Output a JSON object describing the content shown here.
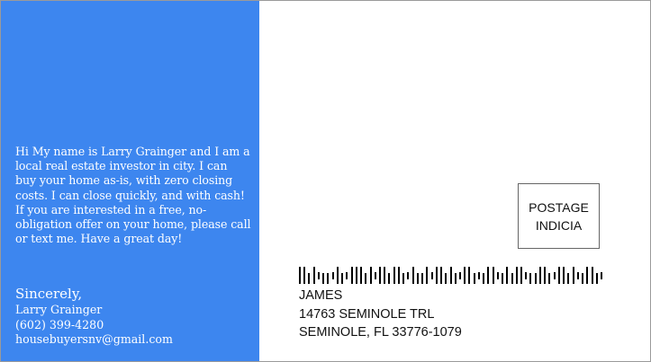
{
  "message": "Hi My name is Larry Grainger and I am a local real estate investor in city. I can buy your home as-is, with zero closing costs. I can close quickly, and with cash! If you are interested in a free, no-obligation offer on your home, please call or text me. Have a great day!",
  "closing": {
    "salutation": "Sincerely,",
    "name": "Larry Grainger",
    "phone": "(602) 399-4280",
    "email": "housebuyersnv@gmail.com"
  },
  "postage": {
    "line1": "POSTAGE",
    "line2": "INDICIA"
  },
  "recipient": {
    "name": "JAMES",
    "street": "14763 SEMINOLE TRL",
    "city_state_zip": "SEMINOLE, FL 33776-1079"
  },
  "colors": {
    "left_panel": "#3d86ef",
    "text_on_panel": "#ffffff",
    "barcode": "#000000"
  },
  "icons": {
    "barcode": "postal-barcode"
  }
}
